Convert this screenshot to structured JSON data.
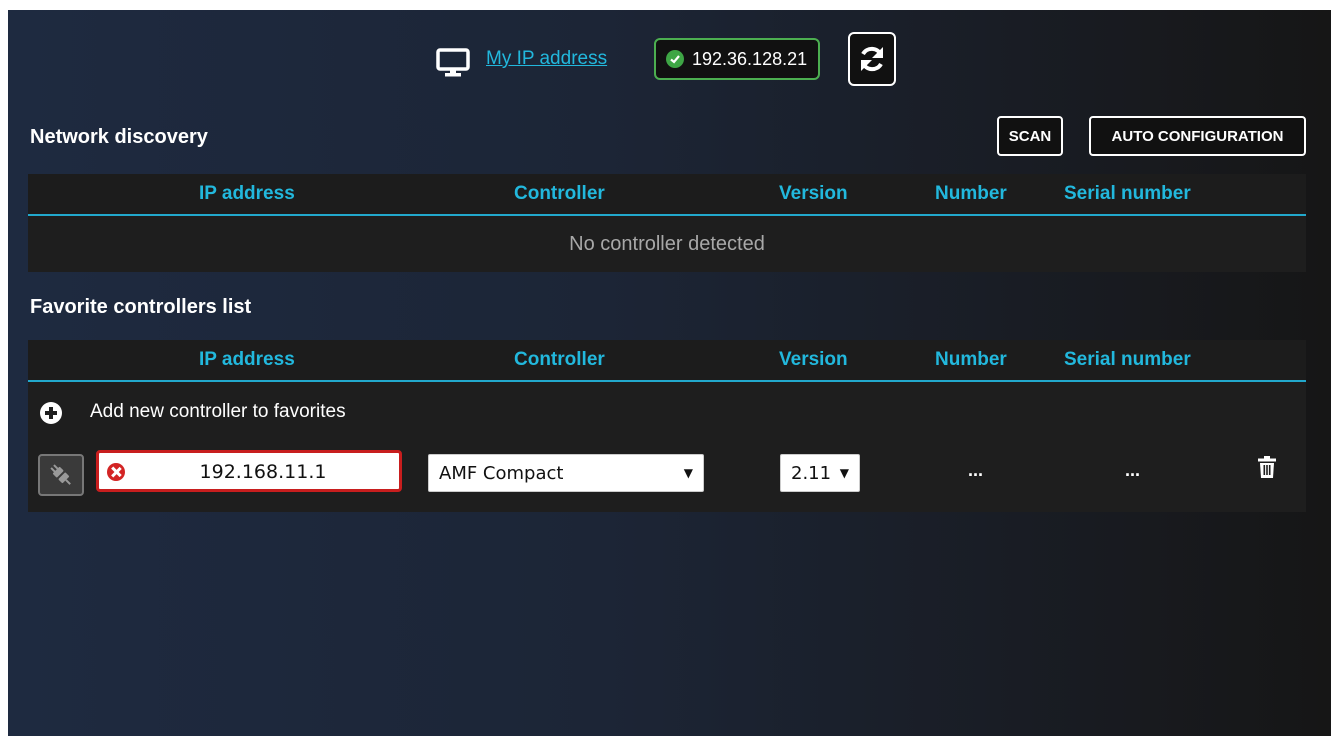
{
  "header": {
    "my_ip_label": "My IP address",
    "ip_value": "192.36.128.21"
  },
  "discovery": {
    "title": "Network discovery",
    "scan_label": "SCAN",
    "auto_config_label": "AUTO CONFIGURATION",
    "columns": [
      "IP address",
      "Controller",
      "Version",
      "Number",
      "Serial number"
    ],
    "empty_text": "No controller detected"
  },
  "favorites": {
    "title": "Favorite controllers list",
    "columns": [
      "IP address",
      "Controller",
      "Version",
      "Number",
      "Serial number"
    ],
    "add_label": "Add new controller to favorites",
    "rows": [
      {
        "ip": "192.168.11.1",
        "controller": "AMF Compact",
        "version": "2.11",
        "number": "...",
        "serial": "..."
      }
    ]
  },
  "colors": {
    "accent": "#22b8dd",
    "ok": "#4caf50",
    "error": "#c81e1e"
  }
}
